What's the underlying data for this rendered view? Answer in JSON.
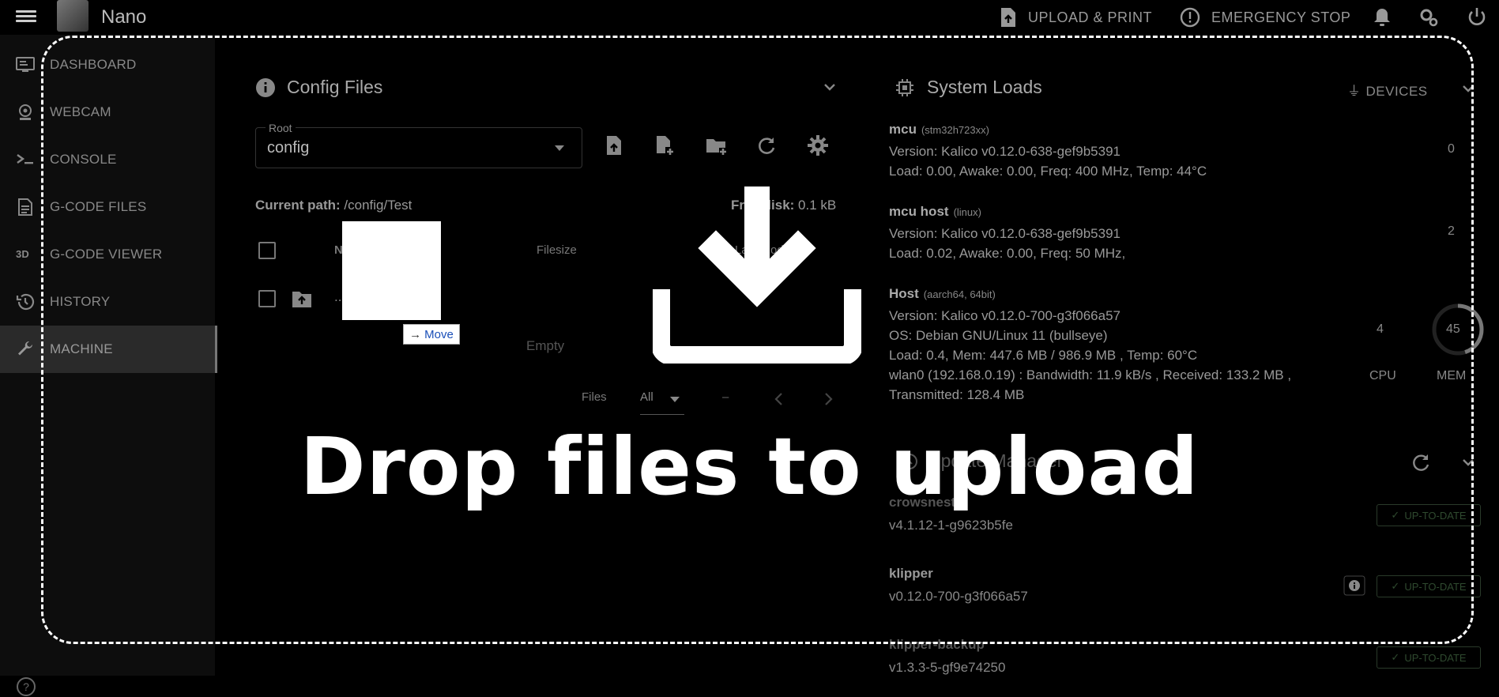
{
  "app": {
    "title": "Nano"
  },
  "topbar": {
    "upload_print": "UPLOAD & PRINT",
    "emergency_stop": "EMERGENCY STOP"
  },
  "sidebar": {
    "items": [
      {
        "label": "DASHBOARD",
        "icon": "monitor-dashboard-icon"
      },
      {
        "label": "WEBCAM",
        "icon": "webcam-icon"
      },
      {
        "label": "CONSOLE",
        "icon": "console-icon"
      },
      {
        "label": "G-CODE FILES",
        "icon": "file-document-icon"
      },
      {
        "label": "G-CODE VIEWER",
        "icon": "3d-icon"
      },
      {
        "label": "HISTORY",
        "icon": "history-icon"
      },
      {
        "label": "MACHINE",
        "icon": "wrench-icon",
        "active": true
      }
    ],
    "viewer_glyph": "3D"
  },
  "config_files": {
    "title": "Config Files",
    "root_label": "Root",
    "root_value": "config",
    "current_path_label": "Current path:",
    "current_path": "/config/Test",
    "free_disk_label": "Free disk:",
    "free_disk": "0.1 kB",
    "columns": {
      "name": "N",
      "filesize": "Filesize",
      "last_modified": "Last modified"
    },
    "parent_dir": "..",
    "empty": "Empty",
    "footer": {
      "files_label": "Files",
      "filter_value": "All",
      "range": "–"
    }
  },
  "system_loads": {
    "title": "System Loads",
    "devices_label": "DEVICES",
    "mcu": {
      "name": "mcu",
      "chip": "(stm32h723xx)",
      "version": "Version: Kalico v0.12.0-638-gef9b5391",
      "load": "Load: 0.00, Awake: 0.00, Freq: 400 MHz, Temp: 44°C",
      "gauge_value": "0"
    },
    "mcu_host": {
      "name": "mcu host",
      "chip": "(linux)",
      "version": "Version: Kalico v0.12.0-638-gef9b5391",
      "load": "Load: 0.02, Awake: 0.00, Freq: 50 MHz,",
      "gauge_value": "2"
    },
    "host": {
      "name": "Host",
      "chip": "(aarch64, 64bit)",
      "version": "Version: Kalico v0.12.0-700-g3f066a57",
      "os": "OS: Debian GNU/Linux 11 (bullseye)",
      "load": "Load: 0.4, Mem: 447.6 MB / 986.9 MB , Temp: 60°C",
      "net": "wlan0 (192.168.0.19) : Bandwidth: 11.9 kB/s , Received: 133.2 MB ,",
      "net2": "Transmitted: 128.4 MB",
      "cpu_value": "4",
      "cpu_label": "CPU",
      "mem_value": "45",
      "mem_label": "MEM",
      "mem_fraction": 0.45
    }
  },
  "update_manager": {
    "title": "Update Manager",
    "items": [
      {
        "name": "crowsnest",
        "version": "v4.1.12-1-g9623b5fe",
        "status": "UP-TO-DATE"
      },
      {
        "name": "klipper",
        "version": "v0.12.0-700-g3f066a57",
        "status": "UP-TO-DATE"
      },
      {
        "name": "klipper-backup",
        "version": "v1.3.3-5-gf9e74250",
        "status": "UP-TO-DATE"
      }
    ]
  },
  "overlay": {
    "drop_text": "Drop files to upload",
    "move_tooltip": "Move"
  }
}
